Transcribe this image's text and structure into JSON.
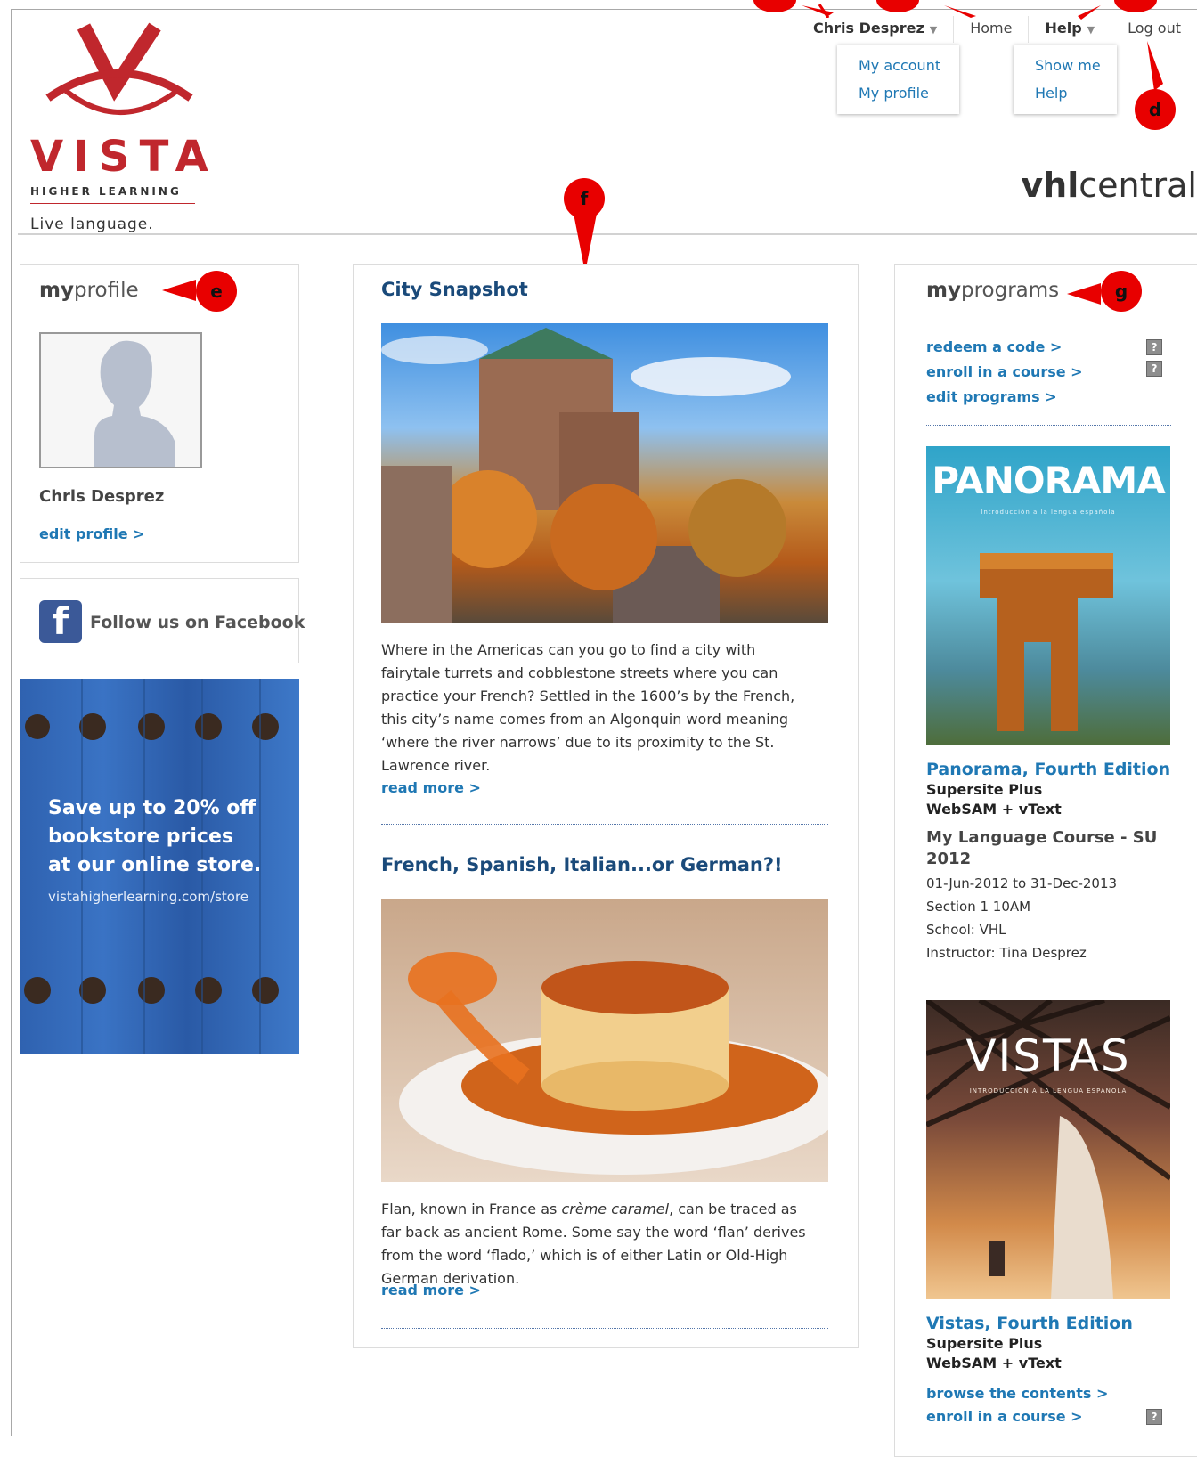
{
  "nav": {
    "user": "Chris Desprez",
    "home": "Home",
    "help": "Help",
    "logout": "Log out",
    "user_menu": [
      "My account",
      "My profile"
    ],
    "help_menu": [
      "Show me",
      "Help"
    ]
  },
  "logo": {
    "name": "VISTA",
    "tagline1": "HIGHER LEARNING",
    "tagline2": "Live language."
  },
  "brand": {
    "bold": "vhl",
    "rest": "central"
  },
  "markers": {
    "d": "d",
    "e": "e",
    "f": "f",
    "g": "g"
  },
  "profile": {
    "head_bold": "my",
    "head_rest": "profile",
    "name": "Chris Desprez",
    "edit": "edit profile >"
  },
  "facebook": {
    "label": "Follow us on Facebook"
  },
  "ad": {
    "line1": "Save up to 20% off",
    "line2": "bookstore prices",
    "line3": "at our online store.",
    "url": "vistahigherlearning.com/store"
  },
  "articles": [
    {
      "title": "City Snapshot",
      "body": "Where in the Americas can you go to find a city with fairytale turrets and cobblestone streets where you can practice your French? Settled in the 1600’s by the French, this city’s name comes from an Algonquin word meaning ‘where the river narrows’ due to its proximity to the St. Lawrence river.",
      "more": "read more >"
    },
    {
      "title": "French, Spanish, Italian...or German?!",
      "body_pre": "Flan, known in France as ",
      "body_em": "crème caramel",
      "body_post": ", can be traced as far back as ancient Rome. Some say the word ‘flan’ derives from the word ‘flado,’ which is of either Latin or Old-High German derivation.",
      "more": "read more >"
    }
  ],
  "programs": {
    "head_bold": "my",
    "head_rest": "programs",
    "links": [
      "redeem a code >",
      "enroll in a course >",
      "edit programs >"
    ],
    "items": [
      {
        "cover_title": "PANORAMA",
        "cover_sub": "Introducción a la lengua española",
        "title": "Panorama, Fourth Edition",
        "sub1": "Supersite Plus",
        "sub2": "WebSAM + vText",
        "course": "My Language Course - SU 2012",
        "dates": "01-Jun-2012 to 31-Dec-2013",
        "section": "Section 1 10AM",
        "school": "School: VHL",
        "instructor": "Instructor: Tina Desprez"
      },
      {
        "cover_title": "VISTAS",
        "cover_sub": "INTRODUCCIÓN A LA LENGUA ESPAÑOLA",
        "title": "Vistas, Fourth Edition",
        "sub1": "Supersite Plus",
        "sub2": "WebSAM + vText",
        "browse": "browse the contents >",
        "enroll": "enroll in a course >"
      }
    ]
  }
}
